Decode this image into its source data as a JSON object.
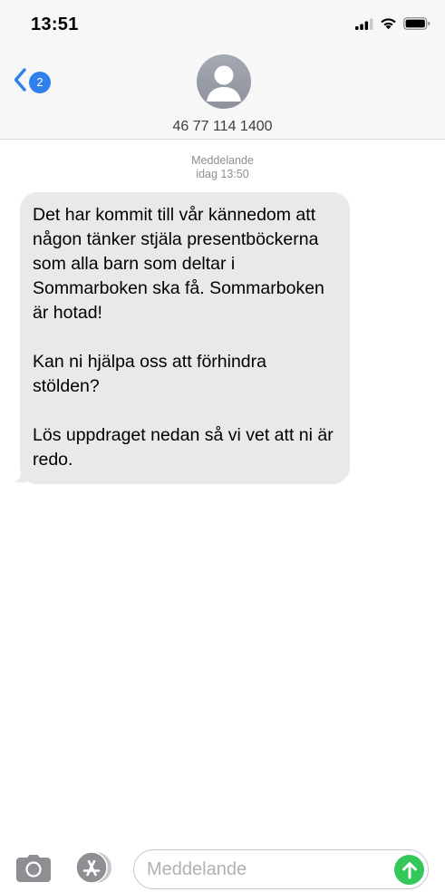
{
  "status_bar": {
    "time": "13:51",
    "icons": [
      "cellular-signal-icon",
      "wifi-icon",
      "battery-icon"
    ]
  },
  "header": {
    "back_badge": "2",
    "contact": "46 77 114 1400",
    "avatar_icon": "person-silhouette-icon"
  },
  "conversation": {
    "service_label": "Meddelande",
    "timestamp": "idag 13:50",
    "messages": [
      {
        "direction": "incoming",
        "paragraphs": [
          "Det har kommit till vår kännedom att någon tänker stjäla presentböckerna som alla barn som deltar i Sommarboken ska få. Sommarboken är hotad!",
          "Kan ni hjälpa oss att förhindra stölden?",
          "Lös uppdraget nedan så vi vet att ni är redo."
        ]
      }
    ]
  },
  "input_bar": {
    "placeholder": "Meddelande",
    "value": "",
    "icons": [
      "camera-icon",
      "app-store-icon",
      "send-arrow-icon"
    ]
  },
  "colors": {
    "accent": "#2f80ed",
    "bubble_incoming": "#e9e9eb",
    "send": "#34c759",
    "header_bg": "#f7f7f7"
  }
}
